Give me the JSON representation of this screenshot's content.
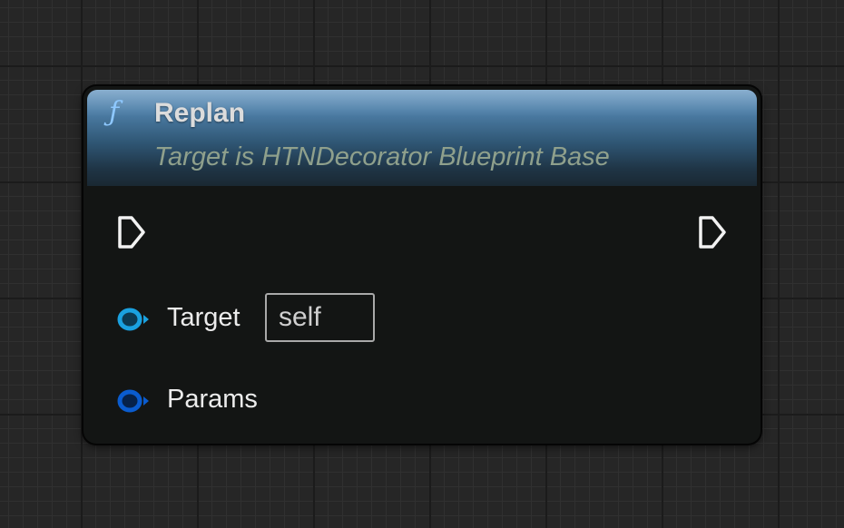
{
  "node": {
    "icon": "function-icon",
    "icon_glyph": "ƒ",
    "title": "Replan",
    "subtitle": "Target is HTNDecorator Blueprint Base"
  },
  "pins": {
    "exec_in": {
      "icon": "exec-pin-icon"
    },
    "exec_out": {
      "icon": "exec-pin-icon"
    },
    "target": {
      "label": "Target",
      "default_value": "self",
      "icon": "object-reference-pin-icon",
      "color": "#1aa1e0"
    },
    "params": {
      "label": "Params",
      "icon": "struct-pin-icon",
      "color": "#0a5ccf"
    }
  },
  "colors": {
    "header_top": "#6f9dc4",
    "header_bottom": "#1a2833",
    "node_body": "#131514",
    "canvas": "#262626"
  }
}
